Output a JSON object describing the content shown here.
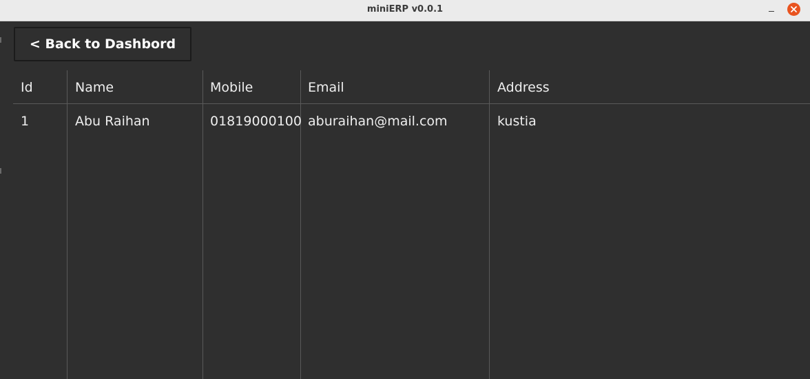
{
  "window": {
    "title": "miniERP v0.0.1"
  },
  "toolbar": {
    "back_label": "< Back to Dashbord"
  },
  "table": {
    "columns": [
      "Id",
      "Name",
      "Mobile",
      "Email",
      "Address"
    ],
    "rows": [
      [
        "1",
        "Abu Raihan",
        "01819000100",
        "aburaihan@mail.com",
        "kustia"
      ]
    ]
  },
  "colors": {
    "background": "#2f2f2f",
    "titlebar": "#ebebeb",
    "close_button": "#e95420",
    "text": "#eeeeee",
    "divider": "#5a5a5a"
  },
  "icons": {
    "minimize": "minimize-icon",
    "close": "close-icon"
  }
}
